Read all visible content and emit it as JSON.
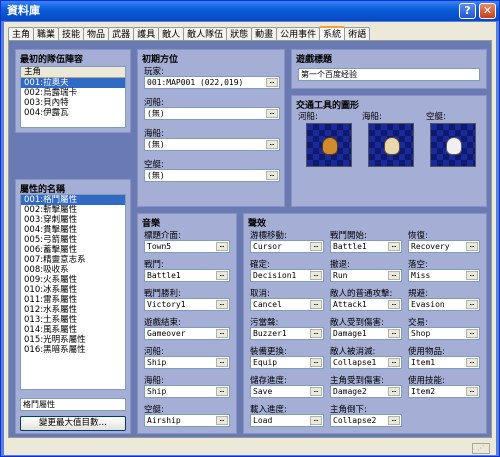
{
  "window": {
    "title": "資料庫",
    "help_glyph": "?",
    "close_glyph": "✕"
  },
  "tabs": [
    "主角",
    "職業",
    "技能",
    "物品",
    "武器",
    "護具",
    "敵人",
    "敵人隊伍",
    "狀態",
    "動畫",
    "公用事件",
    "系統",
    "術語"
  ],
  "active_tab": "系統",
  "party": {
    "title": "最初的隊伍陣容",
    "header": "主角",
    "items": [
      "001:拉奧夫",
      "002:烏露瑞卡",
      "003:貝內特",
      "004:伊露瓦"
    ]
  },
  "elements": {
    "title": "屬性的名稱",
    "items": [
      "001:格鬥屬性",
      "002:斬擊屬性",
      "003:穿刺屬性",
      "004:貫擊屬性",
      "005:弓箭屬性",
      "006:蓄擊屬性",
      "007:精靈意志系",
      "008:吸收系",
      "009:火系屬性",
      "010:冰系屬性",
      "011:雷系屬性",
      "012:水系屬性",
      "013:土系屬性",
      "014:風系屬性",
      "015:光明系屬性",
      "016:黑暗系屬性"
    ],
    "name_value": "格鬥屬性",
    "max_button": "變更最大值目數…"
  },
  "initial_pos": {
    "title": "初期方位",
    "player_label": "玩家:",
    "player_value": "001:MAP001 (022,019)",
    "boat_label": "河船:",
    "boat_value": "(無)",
    "ship_label": "海船:",
    "ship_value": "(無)",
    "airship_label": "空艇:",
    "airship_value": "(無)"
  },
  "game_title": {
    "title": "遊戲標題",
    "value": "第一个百度经验"
  },
  "vehicles": {
    "title": "交通工具的圖形",
    "boat": "河船:",
    "ship": "海船:",
    "airship": "空艇:"
  },
  "music": {
    "title": "音樂",
    "items": [
      {
        "label": "標題介面:",
        "value": "Town5"
      },
      {
        "label": "戰鬥:",
        "value": "Battle1"
      },
      {
        "label": "戰鬥勝利:",
        "value": "Victory1"
      },
      {
        "label": "遊戲結束:",
        "value": "Gameover"
      },
      {
        "label": "河船:",
        "value": "Ship"
      },
      {
        "label": "海船:",
        "value": "Ship"
      },
      {
        "label": "空艇:",
        "value": "Airship"
      }
    ]
  },
  "sounds": {
    "title": "聲效",
    "col1": [
      {
        "label": "游標移動:",
        "value": "Cursor"
      },
      {
        "label": "確定:",
        "value": "Decision1"
      },
      {
        "label": "取消:",
        "value": "Cancel"
      },
      {
        "label": "污當聲:",
        "value": "Buzzer1"
      },
      {
        "label": "裝備更換:",
        "value": "Equip"
      },
      {
        "label": "儲存進度:",
        "value": "Save"
      },
      {
        "label": "載入進度:",
        "value": "Load"
      }
    ],
    "col2": [
      {
        "label": "戰鬥開始:",
        "value": "Battle1"
      },
      {
        "label": "撤退:",
        "value": "Run"
      },
      {
        "label": "敵人的普通攻擊:",
        "value": "Attack1"
      },
      {
        "label": "敵人受到傷害:",
        "value": "Damage1"
      },
      {
        "label": "敵人被消滅:",
        "value": "Collapse1"
      },
      {
        "label": "主角受到傷害:",
        "value": "Damage2"
      },
      {
        "label": "主角倒下:",
        "value": "Collapse2"
      }
    ],
    "col3": [
      {
        "label": "恢復:",
        "value": "Recovery"
      },
      {
        "label": "落空:",
        "value": "Miss"
      },
      {
        "label": "規避:",
        "value": "Evasion"
      },
      {
        "label": "交易:",
        "value": "Shop"
      },
      {
        "label": "使用物品:",
        "value": "Item1"
      },
      {
        "label": "使用技能:",
        "value": "Item2"
      }
    ]
  },
  "dots": "…",
  "grip": "⋰"
}
